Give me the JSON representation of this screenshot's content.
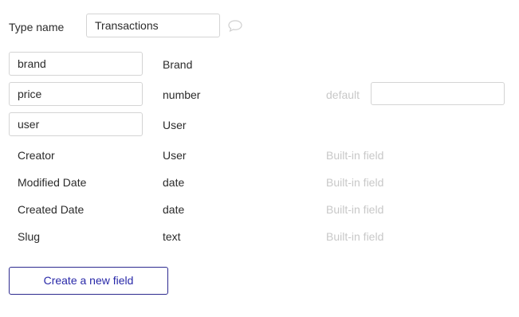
{
  "type_name": {
    "label": "Type name",
    "value": "Transactions",
    "comment_icon": "speech-bubble-icon"
  },
  "fields": [
    {
      "name": "brand",
      "type": "Brand"
    },
    {
      "name": "price",
      "type": "number",
      "default_label": "default",
      "default_value": ""
    },
    {
      "name": "user",
      "type": "User"
    }
  ],
  "builtin_fields": [
    {
      "name": "Creator",
      "type": "User",
      "note": "Built-in field"
    },
    {
      "name": "Modified Date",
      "type": "date",
      "note": "Built-in field"
    },
    {
      "name": "Created Date",
      "type": "date",
      "note": "Built-in field"
    },
    {
      "name": "Slug",
      "type": "text",
      "note": "Built-in field"
    }
  ],
  "create_button": {
    "label": "Create a new field"
  },
  "colors": {
    "accent": "#2828a8",
    "border": "#d4d4d4",
    "muted": "#c8c8c8"
  }
}
